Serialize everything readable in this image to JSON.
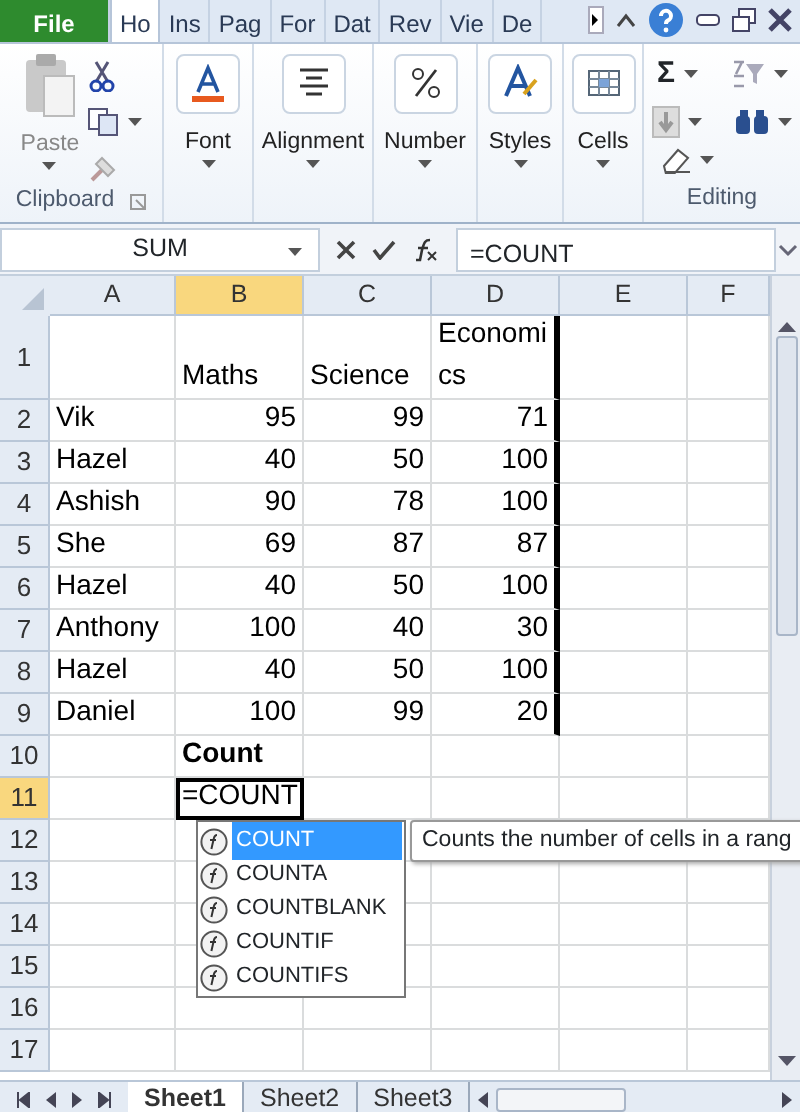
{
  "ribbon_tabs": [
    {
      "label": "File",
      "kind": "file",
      "selected": false
    },
    {
      "label": "Ho",
      "kind": "tab",
      "selected": true
    },
    {
      "label": "Ins",
      "kind": "tab",
      "selected": false
    },
    {
      "label": "Pag",
      "kind": "tab",
      "selected": false
    },
    {
      "label": "For",
      "kind": "tab",
      "selected": false
    },
    {
      "label": "Dat",
      "kind": "tab",
      "selected": false
    },
    {
      "label": "Rev",
      "kind": "tab",
      "selected": false
    },
    {
      "label": "Vie",
      "kind": "tab",
      "selected": false
    },
    {
      "label": "De",
      "kind": "tab",
      "selected": false
    }
  ],
  "ribbon": {
    "clipboard": {
      "paste": "Paste",
      "label": "Clipboard"
    },
    "groups": [
      {
        "label": "Font",
        "kind": "font"
      },
      {
        "label": "Alignment",
        "kind": "alignment"
      },
      {
        "label": "Number",
        "kind": "number"
      },
      {
        "label": "Styles",
        "kind": "styles"
      },
      {
        "label": "Cells",
        "kind": "cells"
      }
    ],
    "editing": {
      "autosum": "Σ",
      "label": "Editing"
    }
  },
  "formula_bar": {
    "name_box": "SUM",
    "formula": "=COUNT"
  },
  "columns": [
    {
      "label": "A",
      "selected": false
    },
    {
      "label": "B",
      "selected": true
    },
    {
      "label": "C",
      "selected": false
    },
    {
      "label": "D",
      "selected": false
    },
    {
      "label": "E",
      "selected": false
    },
    {
      "label": "F",
      "selected": false
    }
  ],
  "rows": [
    {
      "number": "1",
      "selected": false,
      "cells": [
        null,
        {
          "text": "Maths",
          "kind": "text"
        },
        {
          "text": "Science",
          "kind": "text"
        },
        {
          "text": "Economics",
          "kind": "text"
        },
        null,
        null
      ]
    },
    {
      "number": "2",
      "selected": false,
      "cells": [
        {
          "text": "Vik",
          "kind": "text"
        },
        {
          "text": "95",
          "kind": "number"
        },
        {
          "text": "99",
          "kind": "number"
        },
        {
          "text": "71",
          "kind": "number"
        },
        null,
        null
      ]
    },
    {
      "number": "3",
      "selected": false,
      "cells": [
        {
          "text": "Hazel",
          "kind": "text"
        },
        {
          "text": "40",
          "kind": "number"
        },
        {
          "text": "50",
          "kind": "number"
        },
        {
          "text": "100",
          "kind": "number"
        },
        null,
        null
      ]
    },
    {
      "number": "4",
      "selected": false,
      "cells": [
        {
          "text": "Ashish",
          "kind": "text"
        },
        {
          "text": "90",
          "kind": "number"
        },
        {
          "text": "78",
          "kind": "number"
        },
        {
          "text": "100",
          "kind": "number"
        },
        null,
        null
      ]
    },
    {
      "number": "5",
      "selected": false,
      "cells": [
        {
          "text": "She",
          "kind": "text"
        },
        {
          "text": "69",
          "kind": "number"
        },
        {
          "text": "87",
          "kind": "number"
        },
        {
          "text": "87",
          "kind": "number"
        },
        null,
        null
      ]
    },
    {
      "number": "6",
      "selected": false,
      "cells": [
        {
          "text": "Hazel",
          "kind": "text"
        },
        {
          "text": "40",
          "kind": "number"
        },
        {
          "text": "50",
          "kind": "number"
        },
        {
          "text": "100",
          "kind": "number"
        },
        null,
        null
      ]
    },
    {
      "number": "7",
      "selected": false,
      "cells": [
        {
          "text": "Anthony",
          "kind": "text"
        },
        {
          "text": "100",
          "kind": "number"
        },
        {
          "text": "40",
          "kind": "number"
        },
        {
          "text": "30",
          "kind": "number"
        },
        null,
        null
      ]
    },
    {
      "number": "8",
      "selected": false,
      "cells": [
        {
          "text": "Hazel",
          "kind": "text"
        },
        {
          "text": "40",
          "kind": "number"
        },
        {
          "text": "50",
          "kind": "number"
        },
        {
          "text": "100",
          "kind": "number"
        },
        null,
        null
      ]
    },
    {
      "number": "9",
      "selected": false,
      "cells": [
        {
          "text": "Daniel",
          "kind": "text"
        },
        {
          "text": "100",
          "kind": "number"
        },
        {
          "text": "99",
          "kind": "number"
        },
        {
          "text": "20",
          "kind": "number"
        },
        null,
        null
      ]
    },
    {
      "number": "10",
      "selected": false,
      "cells": [
        null,
        {
          "text": "Count",
          "kind": "bold"
        },
        null,
        null,
        null,
        null
      ]
    },
    {
      "number": "11",
      "selected": true,
      "cells": [
        null,
        {
          "text": "=COUNT",
          "kind": "editing"
        },
        null,
        null,
        null,
        null
      ]
    },
    {
      "number": "12",
      "selected": false,
      "cells": [
        null,
        null,
        null,
        null,
        null,
        null
      ]
    },
    {
      "number": "13",
      "selected": false,
      "cells": [
        null,
        null,
        null,
        null,
        null,
        null
      ]
    },
    {
      "number": "14",
      "selected": false,
      "cells": [
        null,
        null,
        null,
        null,
        null,
        null
      ]
    },
    {
      "number": "15",
      "selected": false,
      "cells": [
        null,
        null,
        null,
        null,
        null,
        null
      ]
    },
    {
      "number": "16",
      "selected": false,
      "cells": [
        null,
        null,
        null,
        null,
        null,
        null
      ]
    },
    {
      "number": "17",
      "selected": false,
      "cells": [
        null,
        null,
        null,
        null,
        null,
        null
      ]
    }
  ],
  "autocomplete": {
    "items": [
      {
        "label": "COUNT",
        "selected": true
      },
      {
        "label": "COUNTA",
        "selected": false
      },
      {
        "label": "COUNTBLANK",
        "selected": false
      },
      {
        "label": "COUNTIF",
        "selected": false
      },
      {
        "label": "COUNTIFS",
        "selected": false
      }
    ],
    "tooltip": "Counts the number of cells in a rang"
  },
  "sheet_tabs": [
    {
      "label": "Sheet1",
      "selected": true
    },
    {
      "label": "Sheet2",
      "selected": false
    },
    {
      "label": "Sheet3",
      "selected": false
    }
  ]
}
